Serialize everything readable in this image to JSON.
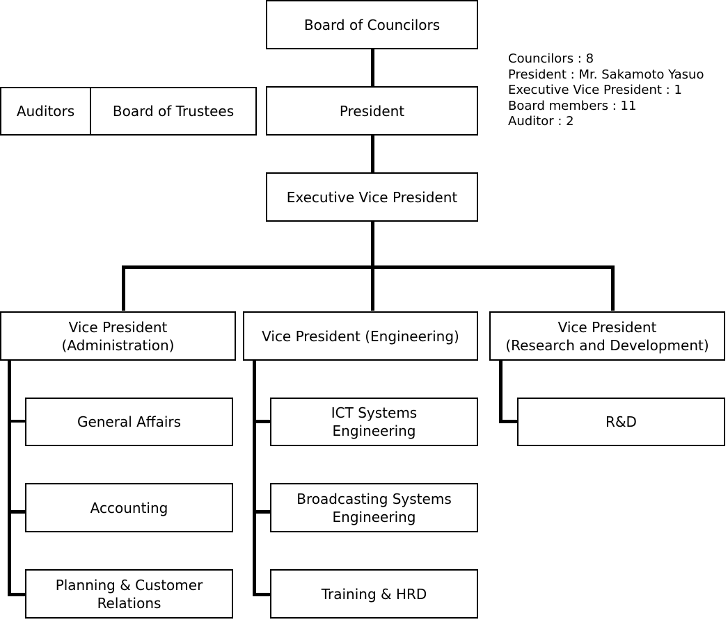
{
  "chart_data": {
    "type": "org-chart",
    "title": "",
    "nodes": [
      {
        "id": "board_of_councilors",
        "label": "Board of Councilors",
        "parent": null
      },
      {
        "id": "president",
        "label": "President",
        "parent": "board_of_councilors"
      },
      {
        "id": "auditors",
        "label": "Auditors",
        "parent": null
      },
      {
        "id": "board_of_trustees",
        "label": "Board of Trustees",
        "parent": null
      },
      {
        "id": "evp",
        "label": "Executive Vice President",
        "parent": "president"
      },
      {
        "id": "vp_admin",
        "label": "Vice President\n(Administration)",
        "parent": "evp"
      },
      {
        "id": "vp_eng",
        "label": "Vice President (Engineering)",
        "parent": "evp"
      },
      {
        "id": "vp_rd",
        "label": "Vice President\n(Research and Development)",
        "parent": "evp"
      },
      {
        "id": "general_affairs",
        "label": "General Affairs",
        "parent": "vp_admin"
      },
      {
        "id": "accounting",
        "label": "Accounting",
        "parent": "vp_admin"
      },
      {
        "id": "planning",
        "label": "Planning & Customer\nRelations",
        "parent": "vp_admin"
      },
      {
        "id": "ict",
        "label": "ICT Systems\nEngineering",
        "parent": "vp_eng"
      },
      {
        "id": "broadcasting",
        "label": "Broadcasting Systems\nEngineering",
        "parent": "vp_eng"
      },
      {
        "id": "training",
        "label": "Training & HRD",
        "parent": "vp_eng"
      },
      {
        "id": "rnd",
        "label": "R&D",
        "parent": "vp_rd"
      }
    ]
  },
  "nodes": {
    "board_of_councilors": "Board of Councilors",
    "auditors": "Auditors",
    "board_of_trustees": "Board of Trustees",
    "president": "President",
    "evp": "Executive Vice President",
    "vp_admin": "Vice President\n(Administration)",
    "vp_eng": "Vice President (Engineering)",
    "vp_rd": "Vice President\n(Research and Development)",
    "general_affairs": "General Affairs",
    "accounting": "Accounting",
    "planning": "Planning & Customer\nRelations",
    "ict": "ICT Systems\nEngineering",
    "broadcasting": "Broadcasting Systems\nEngineering",
    "training": "Training & HRD",
    "rnd": "R&D"
  },
  "info": [
    "Councilors : 8",
    "President : Mr. Sakamoto Yasuo",
    "Executive Vice President : 1",
    "Board members : 11",
    "Auditor : 2"
  ]
}
